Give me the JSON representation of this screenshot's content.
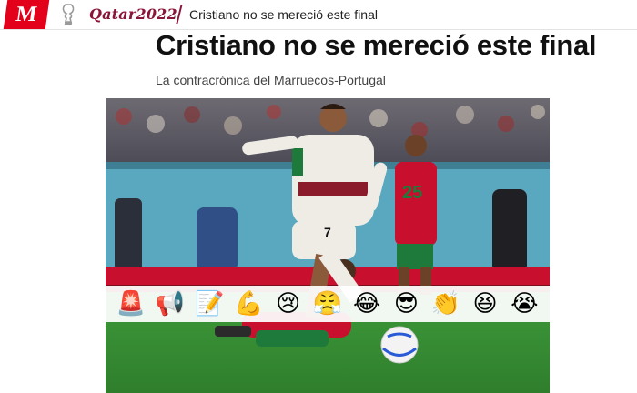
{
  "header": {
    "logo_text": "M",
    "brand": "Qatar2022",
    "breadcrumb": "Cristiano no se mereció este final"
  },
  "article": {
    "title": "Cristiano no se mereció este final",
    "subtitle": "La contracrónica del Marruecos-Portugal"
  },
  "photo": {
    "player_number": "7",
    "opponent_number": "25"
  },
  "reactions": [
    {
      "name": "siren",
      "glyph": "🚨"
    },
    {
      "name": "megaphone",
      "glyph": "📢"
    },
    {
      "name": "memo",
      "glyph": "📝"
    },
    {
      "name": "flexed-biceps",
      "glyph": "💪"
    },
    {
      "name": "crying-face",
      "glyph": "😢"
    },
    {
      "name": "triumph-face",
      "glyph": "😤"
    },
    {
      "name": "tears-of-joy",
      "glyph": "😂"
    },
    {
      "name": "sunglasses-face",
      "glyph": "😎"
    },
    {
      "name": "clapping-hands",
      "glyph": "👏"
    },
    {
      "name": "grinning-squinting",
      "glyph": "😆"
    },
    {
      "name": "loudly-crying",
      "glyph": "😭"
    }
  ],
  "colors": {
    "brand_red": "#e2001a",
    "qatar_maroon": "#8a1538"
  }
}
